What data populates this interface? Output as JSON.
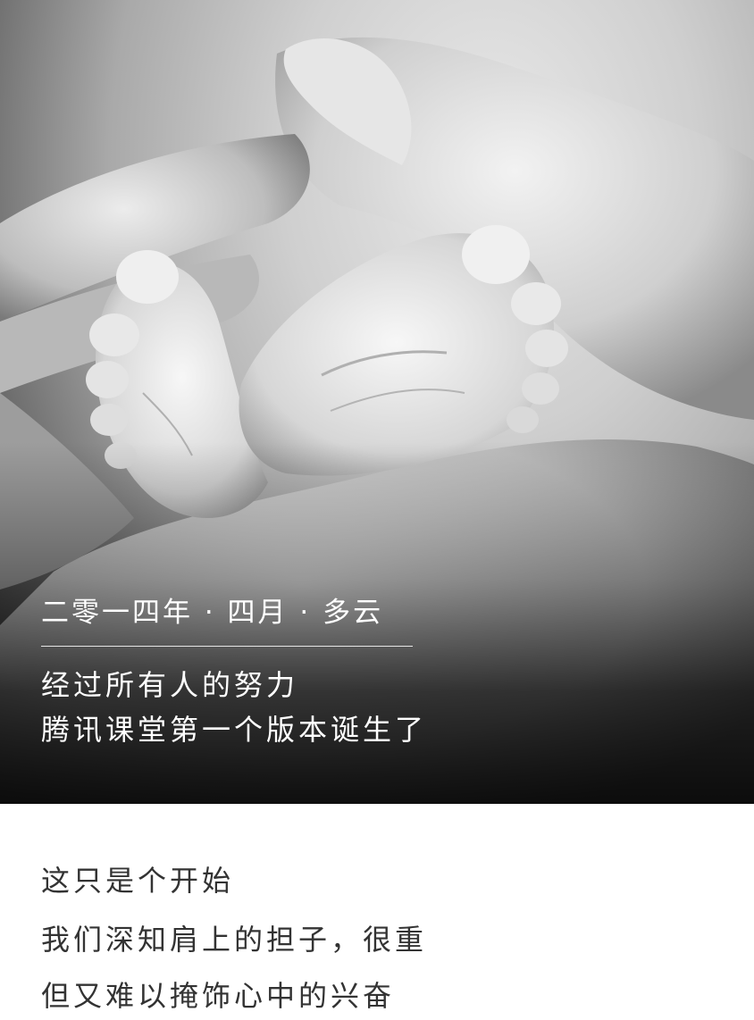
{
  "hero": {
    "photo_icon": "baby-feet-in-hands-photo",
    "date": "二零一四年 · 四月 · 多云",
    "line1": "经过所有人的努力",
    "line2": "腾讯课堂第一个版本诞生了"
  },
  "body": {
    "lines": [
      "这只是个开始",
      "我们深知肩上的担子，很重",
      "但又难以掩饰心中的兴奋"
    ]
  },
  "colors": {
    "hero_text": "#ffffff",
    "body_text": "#333333",
    "background": "#ffffff"
  }
}
